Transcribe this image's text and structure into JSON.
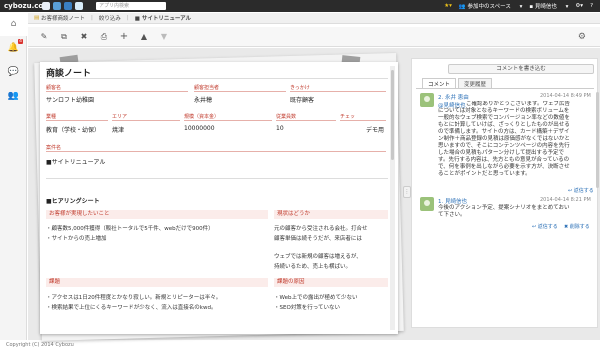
{
  "topbar": {
    "logo": "cybozu.com",
    "search_placeholder": "アプリ内検索",
    "space_menu": "参加中のスペース",
    "user": "見崎信也"
  },
  "rail": {
    "badge": "4"
  },
  "breadcrumb": {
    "app": "お客様商談ノート",
    "filter": "絞り込み",
    "record": "サイトリニューアル"
  },
  "record": {
    "title": "商談ノート",
    "fields": {
      "customer_label": "顧客名",
      "customer": "サンロフト幼稚園",
      "owner_label": "顧客担当者",
      "owner": "永井穂",
      "trigger_label": "きっかけ",
      "trigger": "既存顧客",
      "industry_label": "業種",
      "industry": "教育（学校・幼保）",
      "area_label": "エリア",
      "area": "焼津",
      "budget_label": "規模（資本金）",
      "budget": "10000000",
      "staff_label": "従業員数",
      "staff": "10",
      "check_label": "チェッ",
      "check": "デモ用",
      "case_label": "案件名",
      "case": "■サイトリニューアル"
    },
    "hearing": {
      "section": "■ヒアリングシート",
      "want_label": "お客様が実現したいこと",
      "want_1": "・顧客数5,000件獲得（販社トータルで5千件、webだけで900件）",
      "want_2": "・サイトからの売上増加",
      "now_label": "現状はどうか",
      "now_1": "元の顧客から受注される会社。打合せ",
      "now_2": "顧客単価は続そうだが、来店者には",
      "now_3": "ウェブでは新規の顧客は増えるが、",
      "now_4": "持続いるため、売上も横ばい。",
      "issue_label": "課題",
      "issue_1": "・アクセスは1日20件程度とかなり寂しい。新規とリピーターは半々。",
      "issue_2": "・検索結果で上位にくるキーワードが少なく、流入は直接名のkwd。",
      "cause_label": "課題の原因",
      "cause_1": "・Web上での露出が極めて少ない",
      "cause_2": "・SEO対策を行っていない"
    }
  },
  "comments": {
    "post_button": "コメントを書き込む",
    "tab_comments": "コメント",
    "tab_history": "変更履歴",
    "items": [
      {
        "header": "2. 永井 恵由",
        "date": "2014-04-14 8:49 PM",
        "mention": "@見崎信也",
        "text": "ご確認ありがとうございます。ウェブ広告については対象となるキーワードの検索ボリュームを一般的なウェブ検索でコンバージョン率などの数値をもとに計算していけば、ざっくりとしたものが出せるので準備します。サイトの方は、カード構築＋デザイン制作＋商品登録の見積は原価感がなくではないかと思いますので、そこにコンテンツページの内容を先行した場合の見積もパターン分けして提出する予定です。先行する内容は、先方ともの意見が合っているので、何を事例を出しながら必要を示す方が、決断させることがポイントだと思っています。",
        "reply": "返信する"
      },
      {
        "header": "1. 見崎信也",
        "date": "2014-04-14 8:21 PM",
        "text": "今後のアクション予定、提案シナリオをまとめておいて下さい。",
        "reply": "返信する",
        "delete": "削除する"
      }
    ]
  },
  "footer": "Copyright (C) 2014 Cybozu"
}
